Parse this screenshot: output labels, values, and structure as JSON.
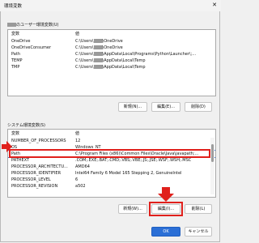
{
  "window": {
    "title": "環境変数",
    "close_glyph": "✕"
  },
  "user_section": {
    "label": "のユーザー環境変数(U)",
    "header": {
      "name": "変数",
      "value": "値"
    },
    "rows": [
      {
        "name": "OneDrive",
        "value_prefix": "C:\\Users\\",
        "value_suffix": "\\OneDrive"
      },
      {
        "name": "OneDriveConsumer",
        "value_prefix": "C:\\Users\\",
        "value_suffix": "\\OneDrive"
      },
      {
        "name": "Path",
        "value_prefix": "C:\\Users\\",
        "value_suffix": "\\AppData\\Local\\Programs\\Python\\Launcher\\;..."
      },
      {
        "name": "TEMP",
        "value_prefix": "C:\\Users\\",
        "value_suffix": "\\AppData\\Local\\Temp"
      },
      {
        "name": "TMP",
        "value_prefix": "C:\\Users\\",
        "value_suffix": "\\AppData\\Local\\Temp"
      }
    ],
    "buttons": {
      "new": "新規(N)...",
      "edit": "編集(E)...",
      "delete": "削除(D)"
    }
  },
  "system_section": {
    "label": "システム環境変数(S)",
    "header": {
      "name": "変数",
      "value": "値"
    },
    "rows": [
      {
        "name": "NUMBER_OF_PROCESSORS",
        "value": "12"
      },
      {
        "name": "OS",
        "value": "Windows_NT"
      },
      {
        "name": "Path",
        "value": "C:\\Program Files (x86)\\Common Files\\Oracle\\Java\\javapath;..."
      },
      {
        "name": "PATHEXT",
        "value": ".COM;.EXE;.BAT;.CMD;.VBS;.VBE;.JS;.JSE;.WSF;.WSH;.MSC"
      },
      {
        "name": "PROCESSOR_ARCHITECTU...",
        "value": "AMD64"
      },
      {
        "name": "PROCESSOR_IDENTIFIER",
        "value": "Intel64 Family 6 Model 165 Stepping 2, GenuineIntel"
      },
      {
        "name": "PROCESSOR_LEVEL",
        "value": "6"
      },
      {
        "name": "PROCESSOR_REVISION",
        "value": "a502"
      }
    ],
    "buttons": {
      "new": "新規(W)...",
      "edit": "編集(I)...",
      "delete": "削除(L)"
    }
  },
  "footer": {
    "ok": "OK",
    "cancel": "キャンセル"
  },
  "colors": {
    "accent": "#2b6fd6",
    "annotation": "#e0201c"
  }
}
